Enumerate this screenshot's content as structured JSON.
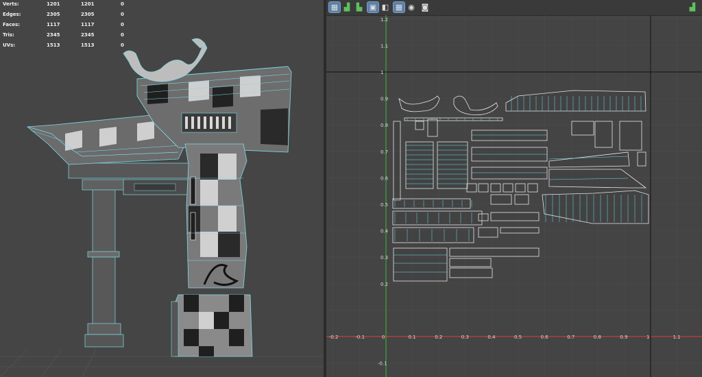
{
  "hud": {
    "rows": [
      {
        "label": "Verts:",
        "v1": "1201",
        "v2": "1201",
        "v3": "0"
      },
      {
        "label": "Edges:",
        "v1": "2305",
        "v2": "2305",
        "v3": "0"
      },
      {
        "label": "Faces:",
        "v1": "1117",
        "v2": "1117",
        "v3": "0"
      },
      {
        "label": "Tris:",
        "v1": "2345",
        "v2": "2345",
        "v3": "0"
      },
      {
        "label": "UVs:",
        "v1": "1513",
        "v2": "1513",
        "v3": "0"
      }
    ]
  },
  "uv_editor": {
    "toolbar": {
      "icons": [
        "uv-layout-icon",
        "uv-shell-icon",
        "uv-grid-icon",
        "uv-texture-icon",
        "uv-isolate-icon",
        "uv-checker-icon",
        "uv-dim-icon",
        "uv-snapshot-icon",
        "uv-display-icon"
      ]
    },
    "x_ticks": [
      "-0.2",
      "-0.1",
      "0",
      "0.1",
      "0.2",
      "0.3",
      "0.4",
      "0.5",
      "0.6",
      "0.7",
      "0.8",
      "0.9",
      "1",
      "1.1"
    ],
    "y_ticks": [
      "-0.1",
      "0.2",
      "0.3",
      "0.4",
      "0.5",
      "0.6",
      "0.7",
      "0.8",
      "0.9",
      "1",
      "1.1",
      "1.2"
    ]
  },
  "colors": {
    "wire": "#6fe0f0",
    "uv_shell": "#e8e8e8",
    "x_axis": "#c43c3c",
    "y_axis": "#3ca83c",
    "bound": "#1c1c1c",
    "grid": "#4d4d4d"
  }
}
